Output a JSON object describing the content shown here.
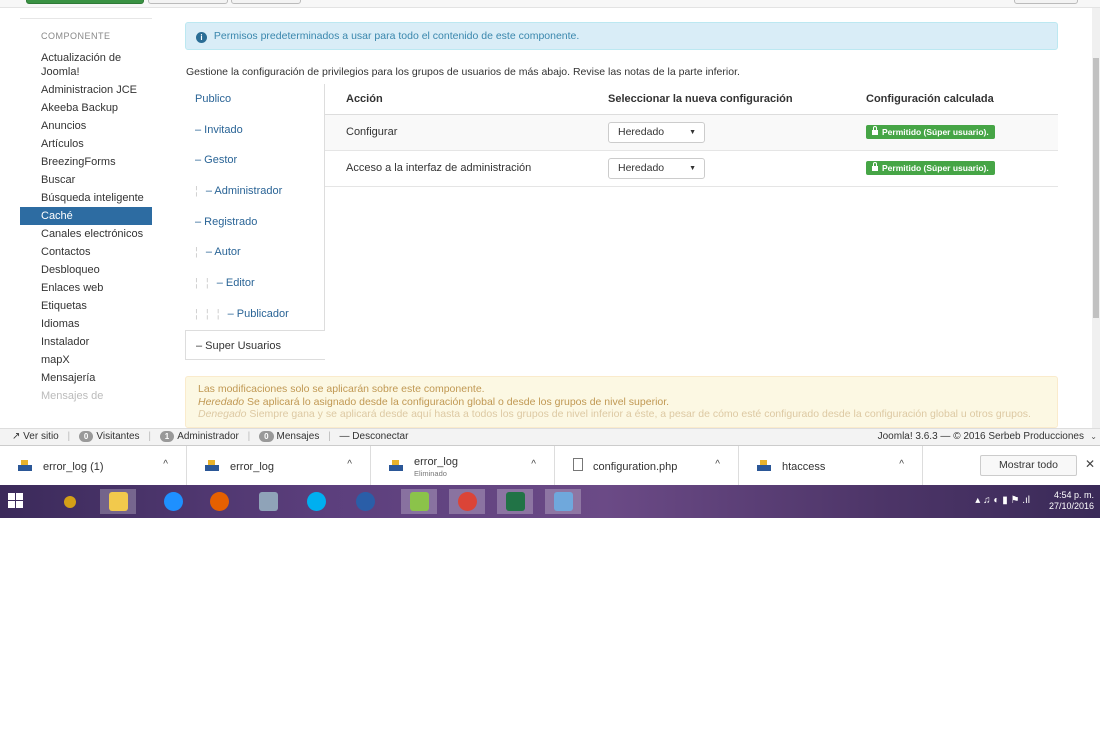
{
  "sidebar": {
    "heading": "COMPONENTE",
    "items": [
      {
        "label": "Actualización de Joomla!"
      },
      {
        "label": "Administracion JCE"
      },
      {
        "label": "Akeeba Backup"
      },
      {
        "label": "Anuncios"
      },
      {
        "label": "Artículos"
      },
      {
        "label": "BreezingForms"
      },
      {
        "label": "Buscar"
      },
      {
        "label": "Búsqueda inteligente"
      },
      {
        "label": "Caché"
      },
      {
        "label": "Canales electrónicos"
      },
      {
        "label": "Contactos"
      },
      {
        "label": "Desbloqueo"
      },
      {
        "label": "Enlaces web"
      },
      {
        "label": "Etiquetas"
      },
      {
        "label": "Idiomas"
      },
      {
        "label": "Instalador"
      },
      {
        "label": "mapX"
      },
      {
        "label": "Mensajería"
      },
      {
        "label": "Mensajes de"
      }
    ],
    "active_index": 8
  },
  "info_alert": "Permisos predeterminados a usar para todo el contenido de este componente.",
  "intro": "Gestione la configuración de privilegios para los grupos de usuarios de más abajo. Revise las notas de la parte inferior.",
  "groups": [
    {
      "label": "Publico",
      "depth": 0
    },
    {
      "label": "– Invitado",
      "depth": 0
    },
    {
      "label": "– Gestor",
      "depth": 0
    },
    {
      "label": "– Administrador",
      "depth": 1
    },
    {
      "label": "– Registrado",
      "depth": 0
    },
    {
      "label": "– Autor",
      "depth": 1
    },
    {
      "label": "– Editor",
      "depth": 2
    },
    {
      "label": "– Publicador",
      "depth": 3
    },
    {
      "label": "– Super Usuarios",
      "depth": 0
    }
  ],
  "table": {
    "headers": {
      "action": "Acción",
      "new_setting": "Seleccionar la nueva configuración",
      "calculated": "Configuración calculada"
    },
    "rows": [
      {
        "action": "Configurar",
        "select": "Heredado",
        "calculated": "Permitido (Súper usuario)."
      },
      {
        "action": "Acceso a la interfaz de administración",
        "select": "Heredado",
        "calculated": "Permitido (Súper usuario)."
      }
    ]
  },
  "warning": {
    "line1": "Las modificaciones solo se aplicarán sobre este componente.",
    "line2_term": "Heredado",
    "line2_text": " Se aplicará lo asignado desde la configuración global o desde los grupos de nivel superior.",
    "line3_term": "Denegado",
    "line3_text": " Siempre gana y se aplicará desde aquí hasta a todos los grupos de nivel inferior a éste, a pesar de cómo esté configurado desde la configuración global u otros grupos."
  },
  "statusbar": {
    "view_site": "Ver sitio",
    "visitors_count": "0",
    "visitors_label": "Visitantes",
    "admins_count": "1",
    "admins_label": "Administrador",
    "messages_count": "0",
    "messages_label": "Mensajes",
    "logout": "Desconectar",
    "version": "Joomla! 3.6.3 — © 2016 Serbeb Producciones"
  },
  "downloads": {
    "items": [
      {
        "name": "error_log (1)",
        "sub": ""
      },
      {
        "name": "error_log",
        "sub": ""
      },
      {
        "name": "error_log",
        "sub": "Eliminado"
      },
      {
        "name": "configuration.php",
        "sub": ""
      },
      {
        "name": "htaccess",
        "sub": ""
      }
    ],
    "show_all": "Mostrar todo"
  },
  "taskbar": {
    "time": "4:54 p. m.",
    "date": "27/10/2016"
  },
  "colors": {
    "active_sidebar": "#2d6ca2",
    "success_badge": "#46a546",
    "info_bg": "#d9edf7",
    "warning_bg": "#fcf8e3"
  }
}
